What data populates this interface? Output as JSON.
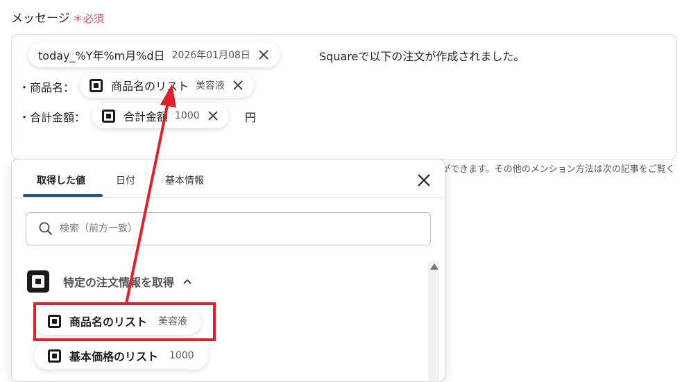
{
  "field": {
    "label": "メッセージ",
    "required_mark": "＊",
    "required_text": "必須"
  },
  "editor": {
    "intro_text": "Squareで以下の注文が作成されました。",
    "line1_prefix": "・商品名：",
    "line2_prefix": "・合計金額：",
    "line2_suffix": "円",
    "pills": [
      {
        "name": "today_%Y年%m月%d日",
        "value": "2026年01月08日"
      },
      {
        "name": "商品名のリスト",
        "value": "美容液"
      },
      {
        "name": "合計金額",
        "value": "1000"
      }
    ]
  },
  "help_text": "ができます。その他のメンション方法は次の記事をご覧く",
  "popup": {
    "tabs": [
      "取得した値",
      "日付",
      "基本情報"
    ],
    "active_tab": 0,
    "search_placeholder": "検索（前方一致）",
    "group_title": "特定の注文情報を取得",
    "items": [
      {
        "name": "商品名のリスト",
        "value": "美容液"
      },
      {
        "name": "基本価格のリスト",
        "value": "1000"
      }
    ]
  },
  "colors": {
    "required": "#e84a5f",
    "tab_underline": "#1f5d78",
    "annotation_red": "#e0202a"
  }
}
